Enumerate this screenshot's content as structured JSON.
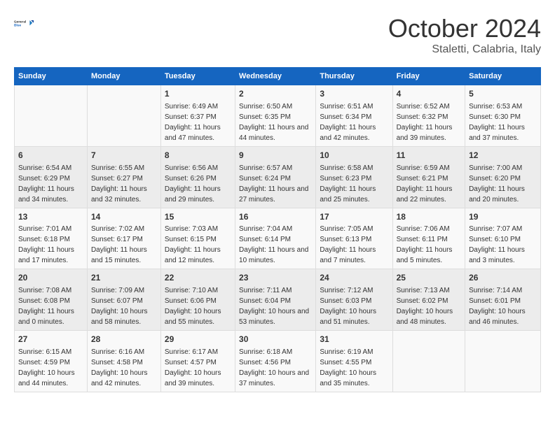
{
  "header": {
    "logo_line1": "General",
    "logo_line2": "Blue",
    "month": "October 2024",
    "location": "Staletti, Calabria, Italy"
  },
  "weekdays": [
    "Sunday",
    "Monday",
    "Tuesday",
    "Wednesday",
    "Thursday",
    "Friday",
    "Saturday"
  ],
  "weeks": [
    [
      {
        "day": "",
        "info": ""
      },
      {
        "day": "",
        "info": ""
      },
      {
        "day": "1",
        "info": "Sunrise: 6:49 AM\nSunset: 6:37 PM\nDaylight: 11 hours and 47 minutes."
      },
      {
        "day": "2",
        "info": "Sunrise: 6:50 AM\nSunset: 6:35 PM\nDaylight: 11 hours and 44 minutes."
      },
      {
        "day": "3",
        "info": "Sunrise: 6:51 AM\nSunset: 6:34 PM\nDaylight: 11 hours and 42 minutes."
      },
      {
        "day": "4",
        "info": "Sunrise: 6:52 AM\nSunset: 6:32 PM\nDaylight: 11 hours and 39 minutes."
      },
      {
        "day": "5",
        "info": "Sunrise: 6:53 AM\nSunset: 6:30 PM\nDaylight: 11 hours and 37 minutes."
      }
    ],
    [
      {
        "day": "6",
        "info": "Sunrise: 6:54 AM\nSunset: 6:29 PM\nDaylight: 11 hours and 34 minutes."
      },
      {
        "day": "7",
        "info": "Sunrise: 6:55 AM\nSunset: 6:27 PM\nDaylight: 11 hours and 32 minutes."
      },
      {
        "day": "8",
        "info": "Sunrise: 6:56 AM\nSunset: 6:26 PM\nDaylight: 11 hours and 29 minutes."
      },
      {
        "day": "9",
        "info": "Sunrise: 6:57 AM\nSunset: 6:24 PM\nDaylight: 11 hours and 27 minutes."
      },
      {
        "day": "10",
        "info": "Sunrise: 6:58 AM\nSunset: 6:23 PM\nDaylight: 11 hours and 25 minutes."
      },
      {
        "day": "11",
        "info": "Sunrise: 6:59 AM\nSunset: 6:21 PM\nDaylight: 11 hours and 22 minutes."
      },
      {
        "day": "12",
        "info": "Sunrise: 7:00 AM\nSunset: 6:20 PM\nDaylight: 11 hours and 20 minutes."
      }
    ],
    [
      {
        "day": "13",
        "info": "Sunrise: 7:01 AM\nSunset: 6:18 PM\nDaylight: 11 hours and 17 minutes."
      },
      {
        "day": "14",
        "info": "Sunrise: 7:02 AM\nSunset: 6:17 PM\nDaylight: 11 hours and 15 minutes."
      },
      {
        "day": "15",
        "info": "Sunrise: 7:03 AM\nSunset: 6:15 PM\nDaylight: 11 hours and 12 minutes."
      },
      {
        "day": "16",
        "info": "Sunrise: 7:04 AM\nSunset: 6:14 PM\nDaylight: 11 hours and 10 minutes."
      },
      {
        "day": "17",
        "info": "Sunrise: 7:05 AM\nSunset: 6:13 PM\nDaylight: 11 hours and 7 minutes."
      },
      {
        "day": "18",
        "info": "Sunrise: 7:06 AM\nSunset: 6:11 PM\nDaylight: 11 hours and 5 minutes."
      },
      {
        "day": "19",
        "info": "Sunrise: 7:07 AM\nSunset: 6:10 PM\nDaylight: 11 hours and 3 minutes."
      }
    ],
    [
      {
        "day": "20",
        "info": "Sunrise: 7:08 AM\nSunset: 6:08 PM\nDaylight: 11 hours and 0 minutes."
      },
      {
        "day": "21",
        "info": "Sunrise: 7:09 AM\nSunset: 6:07 PM\nDaylight: 10 hours and 58 minutes."
      },
      {
        "day": "22",
        "info": "Sunrise: 7:10 AM\nSunset: 6:06 PM\nDaylight: 10 hours and 55 minutes."
      },
      {
        "day": "23",
        "info": "Sunrise: 7:11 AM\nSunset: 6:04 PM\nDaylight: 10 hours and 53 minutes."
      },
      {
        "day": "24",
        "info": "Sunrise: 7:12 AM\nSunset: 6:03 PM\nDaylight: 10 hours and 51 minutes."
      },
      {
        "day": "25",
        "info": "Sunrise: 7:13 AM\nSunset: 6:02 PM\nDaylight: 10 hours and 48 minutes."
      },
      {
        "day": "26",
        "info": "Sunrise: 7:14 AM\nSunset: 6:01 PM\nDaylight: 10 hours and 46 minutes."
      }
    ],
    [
      {
        "day": "27",
        "info": "Sunrise: 6:15 AM\nSunset: 4:59 PM\nDaylight: 10 hours and 44 minutes."
      },
      {
        "day": "28",
        "info": "Sunrise: 6:16 AM\nSunset: 4:58 PM\nDaylight: 10 hours and 42 minutes."
      },
      {
        "day": "29",
        "info": "Sunrise: 6:17 AM\nSunset: 4:57 PM\nDaylight: 10 hours and 39 minutes."
      },
      {
        "day": "30",
        "info": "Sunrise: 6:18 AM\nSunset: 4:56 PM\nDaylight: 10 hours and 37 minutes."
      },
      {
        "day": "31",
        "info": "Sunrise: 6:19 AM\nSunset: 4:55 PM\nDaylight: 10 hours and 35 minutes."
      },
      {
        "day": "",
        "info": ""
      },
      {
        "day": "",
        "info": ""
      }
    ]
  ]
}
